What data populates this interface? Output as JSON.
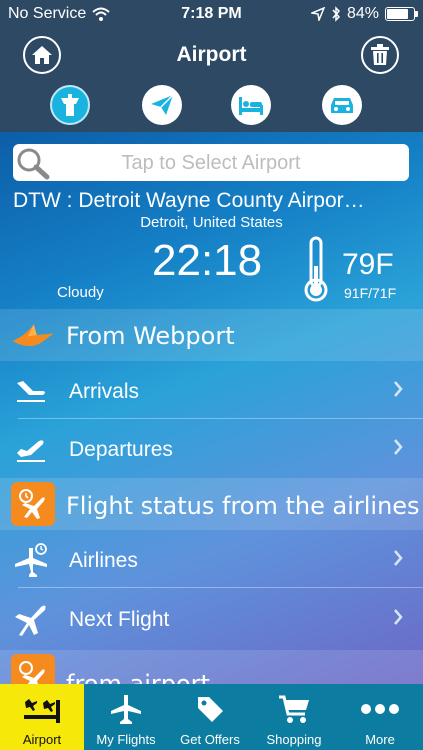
{
  "status_bar": {
    "carrier": "No Service",
    "time": "7:18 PM",
    "battery_percent_text": "84%",
    "battery_level": 0.84
  },
  "nav": {
    "title": "Airport",
    "home_icon": "home-icon",
    "trash_icon": "trash-icon"
  },
  "modes": [
    {
      "icon": "control-tower-icon",
      "active": true
    },
    {
      "icon": "paper-plane-icon",
      "active": false
    },
    {
      "icon": "bed-icon",
      "active": false
    },
    {
      "icon": "car-icon",
      "active": false
    }
  ],
  "search": {
    "placeholder": "Tap to Select Airport"
  },
  "airport": {
    "name": "DTW : Detroit Wayne County Airpor…",
    "city": "Detroit, United States",
    "time": "22:18",
    "condition": "Cloudy",
    "temperature": "79F",
    "temp_range": "91F/71F"
  },
  "sections": [
    {
      "label": "From Webport",
      "icon": "bird-logo-icon"
    },
    {
      "label": "Flight status from the airlines",
      "icon": "flight-clock-icon"
    },
    {
      "label": "from airport",
      "icon": "flight-clock-icon"
    }
  ],
  "rows": [
    {
      "label": "Arrivals",
      "icon": "arrival-plane-icon"
    },
    {
      "label": "Departures",
      "icon": "departure-plane-icon"
    },
    {
      "label": "Airlines",
      "icon": "plane-clock-icon"
    },
    {
      "label": "Next Flight",
      "icon": "plane-icon"
    }
  ],
  "tabs": [
    {
      "label": "Airport",
      "icon": "airport-icon",
      "active": true
    },
    {
      "label": "My Flights",
      "icon": "plane-icon",
      "active": false
    },
    {
      "label": "Get Offers",
      "icon": "tag-icon",
      "active": false
    },
    {
      "label": "Shopping",
      "icon": "cart-icon",
      "active": false
    },
    {
      "label": "More",
      "icon": "more-dots-icon",
      "active": false
    }
  ],
  "colors": {
    "header": "#2d4963",
    "accent_blue": "#1ab3e0",
    "orange": "#f58a1f",
    "tab_bar": "#0c7ca0",
    "tab_active": "#f6e90a"
  }
}
